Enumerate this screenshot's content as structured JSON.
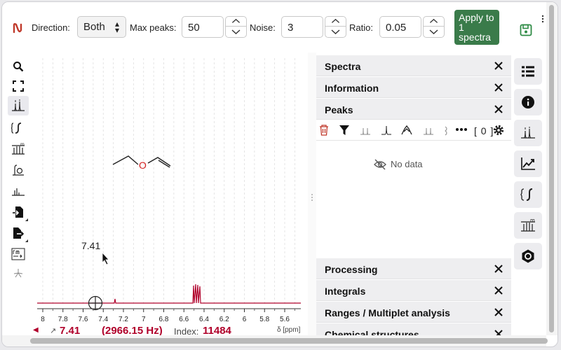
{
  "toolbar": {
    "direction_label": "Direction:",
    "direction_value": "Both",
    "max_peaks_label": "Max peaks:",
    "max_peaks_value": "50",
    "noise_label": "Noise:",
    "noise_value": "3",
    "ratio_label": "Ratio:",
    "ratio_value": "0.05",
    "apply_label": "Apply to 1 spectra",
    "accent_color": "#3a7b4a"
  },
  "left_tools": [
    "search-icon",
    "fullscreen-icon",
    "peak-picking-icon",
    "integral-icon",
    "multiplet-icon",
    "zero-filling-icon",
    "baseline-icon",
    "import-icon",
    "export-icon",
    "phase-correction-icon",
    "apodization-icon"
  ],
  "spectrum": {
    "molecule_heteroatom": "O",
    "cursor_label": "7.41",
    "x_ticks": [
      "8",
      "7.8",
      "7.6",
      "7.4",
      "7.2",
      "7",
      "6.8",
      "6.6",
      "6.4",
      "6.2",
      "6",
      "5.8",
      "5.6"
    ],
    "line_color": "#b0002a"
  },
  "status": {
    "ppm_value": "7.41",
    "hz_value": "(2966.15 Hz)",
    "index_label": "Index:",
    "index_value": "11484",
    "unit_label": "δ [ppm]"
  },
  "panels": {
    "spectra": "Spectra",
    "information": "Information",
    "peaks": "Peaks",
    "peak_count": "[ 0 ]",
    "no_data": "No data",
    "processing": "Processing",
    "integrals": "Integrals",
    "ranges": "Ranges / Multiplet analysis",
    "chemical_structures": "Chemical structures"
  },
  "right_tools": [
    "spectra-list-icon",
    "information-icon",
    "peaks-icon",
    "processing-icon",
    "integrals-icon",
    "multiplet-icon",
    "chemical-structure-icon"
  ]
}
